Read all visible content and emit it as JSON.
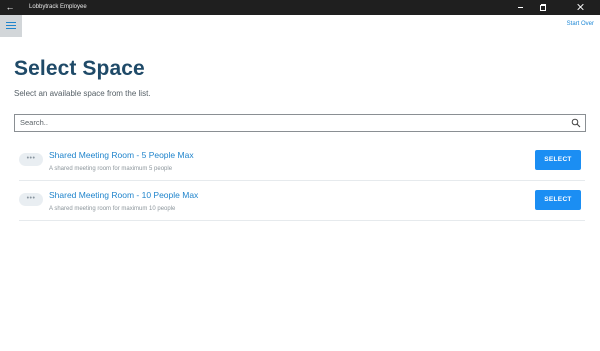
{
  "window": {
    "title": "Lobbytrack Employee",
    "back_icon": "back-arrow-icon"
  },
  "header": {
    "menu_icon": "hamburger-menu-icon",
    "start_over_label": "Start Over"
  },
  "main": {
    "title": "Select Space",
    "subtitle": "Select an available space from the list.",
    "search": {
      "placeholder": "Search..",
      "icon": "search-icon"
    },
    "spaces": [
      {
        "badge": "•••",
        "name": "Shared Meeting Room - 5 People Max",
        "description": "A shared meeting room for maximum 5 people",
        "action_label": "SELECT"
      },
      {
        "badge": "•••",
        "name": "Shared Meeting Room - 10 People Max",
        "description": "A shared meeting room for maximum 10 people",
        "action_label": "SELECT"
      }
    ]
  },
  "colors": {
    "accent": "#1b8ef3",
    "link": "#1f84cc",
    "title": "#1f4a68",
    "titlebar": "#1f1f1f"
  }
}
